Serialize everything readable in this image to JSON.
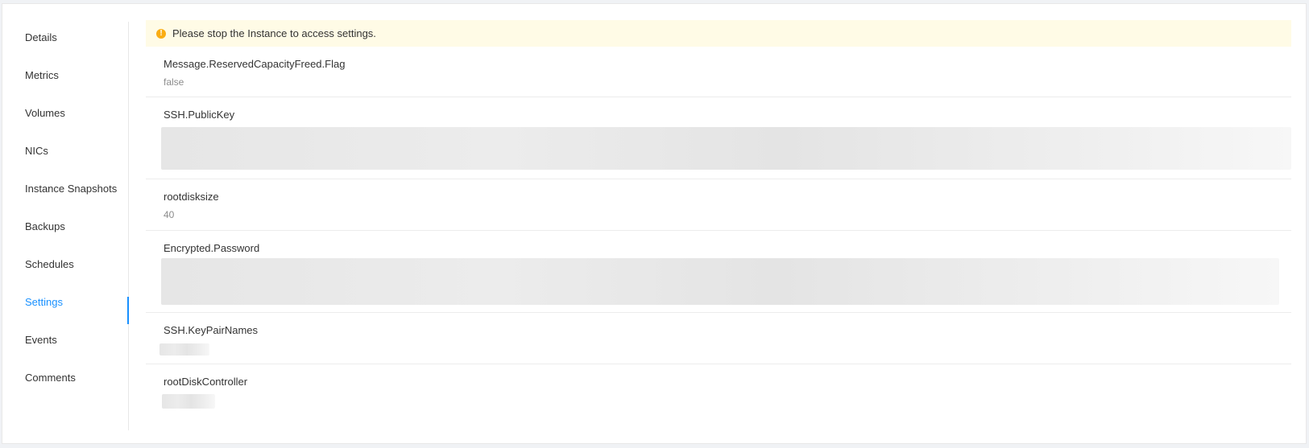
{
  "sidebar": {
    "items": [
      {
        "label": "Details"
      },
      {
        "label": "Metrics"
      },
      {
        "label": "Volumes"
      },
      {
        "label": "NICs"
      },
      {
        "label": "Instance Snapshots"
      },
      {
        "label": "Backups"
      },
      {
        "label": "Schedules"
      },
      {
        "label": "Settings",
        "active": true
      },
      {
        "label": "Events"
      },
      {
        "label": "Comments"
      }
    ]
  },
  "alert": {
    "icon": "exclamation-circle-icon",
    "text": "Please stop the Instance to access settings.",
    "color": "#faad14"
  },
  "settings": [
    {
      "key": "Message.ReservedCapacityFreed.Flag",
      "value": "false"
    },
    {
      "key": "SSH.PublicKey",
      "value": ""
    },
    {
      "key": "rootdisksize",
      "value": "40"
    },
    {
      "key": "Encrypted.Password",
      "value": ""
    },
    {
      "key": "SSH.KeyPairNames",
      "value": ""
    },
    {
      "key": "rootDiskController",
      "value": ""
    }
  ],
  "colors": {
    "accent": "#1890ff",
    "alert_bg": "#fffbe6",
    "alert_icon": "#faad14"
  }
}
